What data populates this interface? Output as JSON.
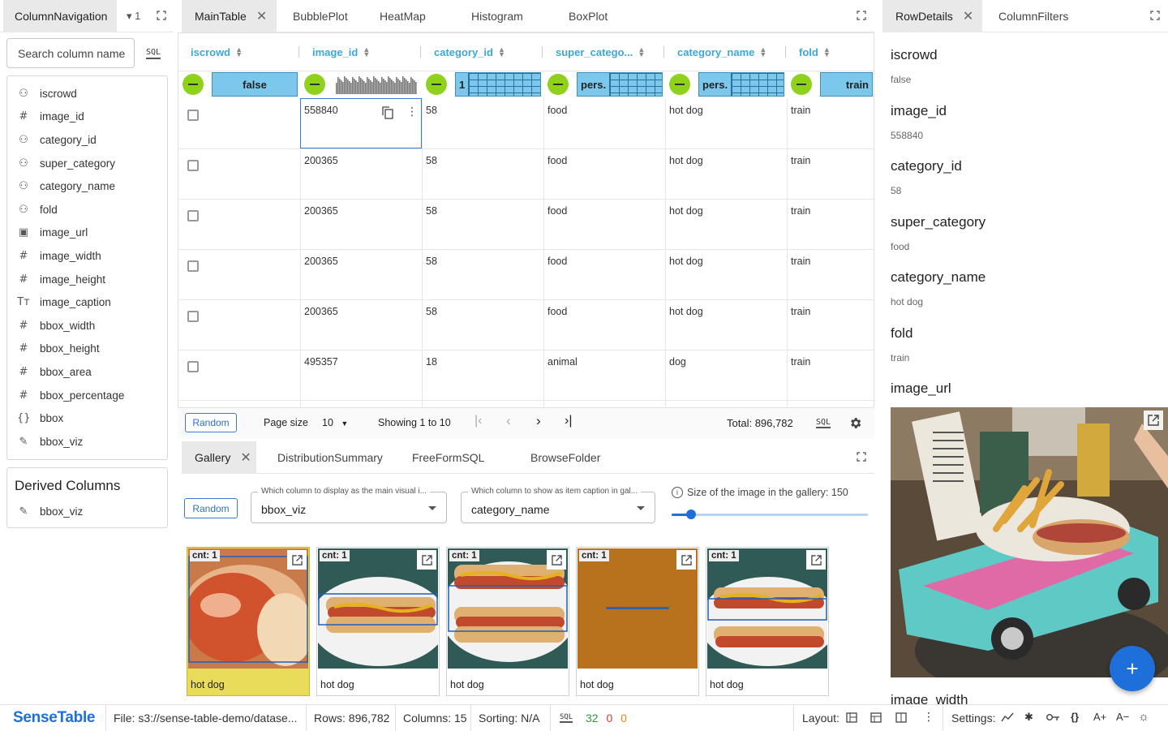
{
  "app": {
    "logo_text": "SenseTable"
  },
  "colnav": {
    "tab_label": "ColumnNavigation",
    "tab_count": "1",
    "search_placeholder": "Search column name",
    "sql_label": "SQL",
    "columns": [
      {
        "icon": "categorical-icon",
        "glyph": "⚇",
        "name": "iscrowd"
      },
      {
        "icon": "number-icon",
        "glyph": "#",
        "name": "image_id"
      },
      {
        "icon": "categorical-icon",
        "glyph": "⚇",
        "name": "category_id"
      },
      {
        "icon": "categorical-icon",
        "glyph": "⚇",
        "name": "super_category"
      },
      {
        "icon": "categorical-icon",
        "glyph": "⚇",
        "name": "category_name"
      },
      {
        "icon": "categorical-icon",
        "glyph": "⚇",
        "name": "fold"
      },
      {
        "icon": "image-icon",
        "glyph": "▣",
        "name": "image_url"
      },
      {
        "icon": "number-icon",
        "glyph": "#",
        "name": "image_width"
      },
      {
        "icon": "number-icon",
        "glyph": "#",
        "name": "image_height"
      },
      {
        "icon": "text-icon",
        "glyph": "Tт",
        "name": "image_caption"
      },
      {
        "icon": "number-icon",
        "glyph": "#",
        "name": "bbox_width"
      },
      {
        "icon": "number-icon",
        "glyph": "#",
        "name": "bbox_height"
      },
      {
        "icon": "number-icon",
        "glyph": "#",
        "name": "bbox_area"
      },
      {
        "icon": "number-icon",
        "glyph": "#",
        "name": "bbox_percentage"
      },
      {
        "icon": "json-icon",
        "glyph": "{}",
        "name": "bbox"
      },
      {
        "icon": "brush-icon",
        "glyph": "✎",
        "name": "bbox_viz"
      }
    ],
    "derived_title": "Derived Columns",
    "derived": [
      {
        "icon": "brush-icon",
        "glyph": "✎",
        "name": "bbox_viz"
      }
    ]
  },
  "main_tabs": [
    "MainTable",
    "BubblePlot",
    "HeatMap",
    "Histogram",
    "BoxPlot"
  ],
  "table": {
    "headers": [
      "iscrowd",
      "image_id",
      "category_id",
      "super_catego...",
      "category_name",
      "fold"
    ],
    "filters": [
      "false",
      "",
      "1",
      "pers.",
      "pers.",
      "train"
    ],
    "rows": [
      [
        "558840",
        "58",
        "food",
        "hot dog",
        "train"
      ],
      [
        "200365",
        "58",
        "food",
        "hot dog",
        "train"
      ],
      [
        "200365",
        "58",
        "food",
        "hot dog",
        "train"
      ],
      [
        "200365",
        "58",
        "food",
        "hot dog",
        "train"
      ],
      [
        "200365",
        "58",
        "food",
        "hot dog",
        "train"
      ],
      [
        "495357",
        "18",
        "animal",
        "dog",
        "train"
      ]
    ],
    "random_label": "Random",
    "page_size_label": "Page size",
    "page_size": "10",
    "showing": "Showing 1 to 10",
    "total_label": "Total:",
    "total_value": "896,782",
    "sql_label": "SQL"
  },
  "bottom_tabs": [
    "Gallery",
    "DistributionSummary",
    "FreeFormSQL",
    "BrowseFolder"
  ],
  "gallery": {
    "random_label": "Random",
    "main_visual_label": "Which column to display as the main visual i...",
    "main_visual_value": "bbox_viz",
    "caption_label": "Which column to show as item caption in gal...",
    "caption_value": "category_name",
    "size_label": "Size of the image in the gallery: 150",
    "size_value": 150,
    "size_fraction": 0.1,
    "items": [
      {
        "cnt": "cnt: 1",
        "caption": "hot dog"
      },
      {
        "cnt": "cnt: 1",
        "caption": "hot dog"
      },
      {
        "cnt": "cnt: 1",
        "caption": "hot dog"
      },
      {
        "cnt": "cnt: 1",
        "caption": "hot dog"
      },
      {
        "cnt": "cnt: 1",
        "caption": "hot dog"
      }
    ]
  },
  "right_tabs": [
    "RowDetails",
    "ColumnFilters"
  ],
  "details": [
    {
      "key": "iscrowd",
      "value": "false"
    },
    {
      "key": "image_id",
      "value": "558840"
    },
    {
      "key": "category_id",
      "value": "58"
    },
    {
      "key": "super_category",
      "value": "food"
    },
    {
      "key": "category_name",
      "value": "hot dog"
    },
    {
      "key": "fold",
      "value": "train"
    },
    {
      "key": "image_url",
      "value": ""
    },
    {
      "key": "image_width",
      "value": ""
    }
  ],
  "status": {
    "file": "File: s3://sense-table-demo/datase...",
    "rows": "Rows: 896,782",
    "columns": "Columns: 15",
    "sorting": "Sorting: N/A",
    "sql_label": "SQL",
    "sql_green": "32",
    "sql_red": "0",
    "sql_orange": "0",
    "layout_label": "Layout:",
    "settings_label": "Settings:"
  },
  "colors": {
    "accent": "#3aa8d8",
    "filter_green": "#8ed21c",
    "filter_blue": "#7bc8ec",
    "fab": "#1e6fd9"
  }
}
